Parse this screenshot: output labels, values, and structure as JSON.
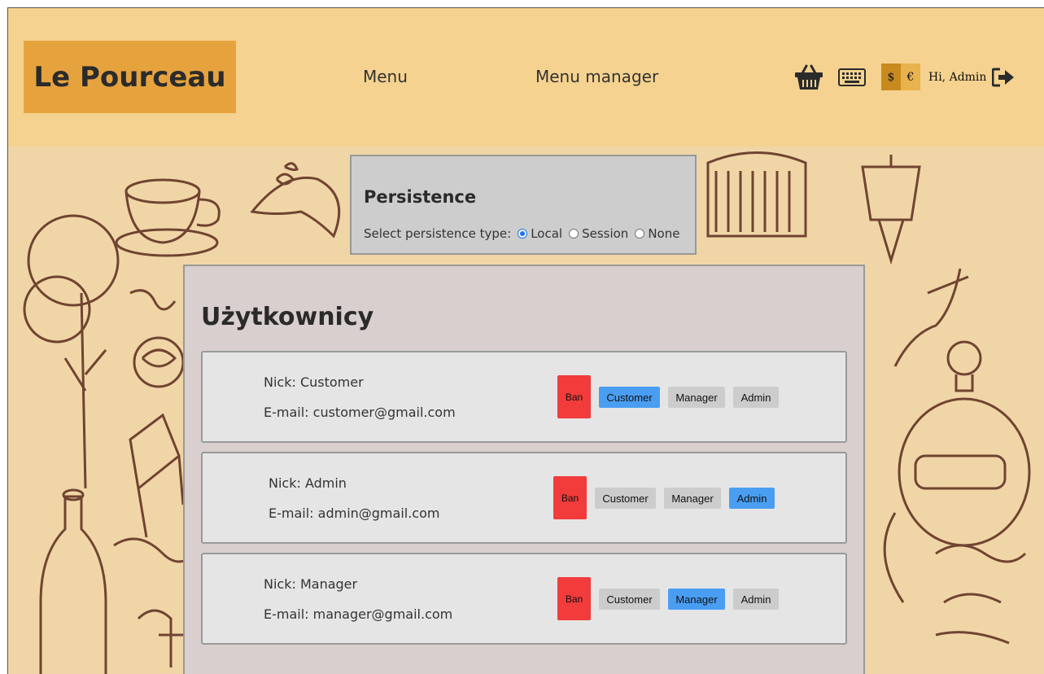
{
  "header": {
    "logo": "Le Pourceau",
    "nav": [
      {
        "label": "Menu"
      },
      {
        "label": "Menu manager"
      }
    ],
    "currency": {
      "options": [
        "$",
        "€"
      ],
      "active": "$"
    },
    "greeting": "Hi, Admin"
  },
  "persistence": {
    "title": "Persistence",
    "label": "Select persistence type:",
    "options": [
      {
        "label": "Local",
        "checked": true
      },
      {
        "label": "Session",
        "checked": false
      },
      {
        "label": "None",
        "checked": false
      }
    ]
  },
  "users": {
    "title": "Użytkownicy",
    "list": [
      {
        "nick": "Nick: Customer",
        "email": "E-mail: customer@gmail.com",
        "ban": "Ban",
        "roles": [
          "Customer",
          "Manager",
          "Admin"
        ],
        "active_role": "Customer"
      },
      {
        "nick": "Nick: Admin",
        "email": "E-mail: admin@gmail.com",
        "ban": "Ban",
        "roles": [
          "Customer",
          "Manager",
          "Admin"
        ],
        "active_role": "Admin"
      },
      {
        "nick": "Nick: Manager",
        "email": "E-mail: manager@gmail.com",
        "ban": "Ban",
        "roles": [
          "Customer",
          "Manager",
          "Admin"
        ],
        "active_role": "Manager"
      }
    ]
  },
  "colors": {
    "header_bg": "#f5d28f",
    "logo_bg": "#e6a33d",
    "ban": "#f23b3b",
    "role_active": "#4a9ef2",
    "role_inactive": "#cccccc"
  },
  "icons": [
    "basket-icon",
    "keyboard-icon",
    "logout-icon"
  ]
}
